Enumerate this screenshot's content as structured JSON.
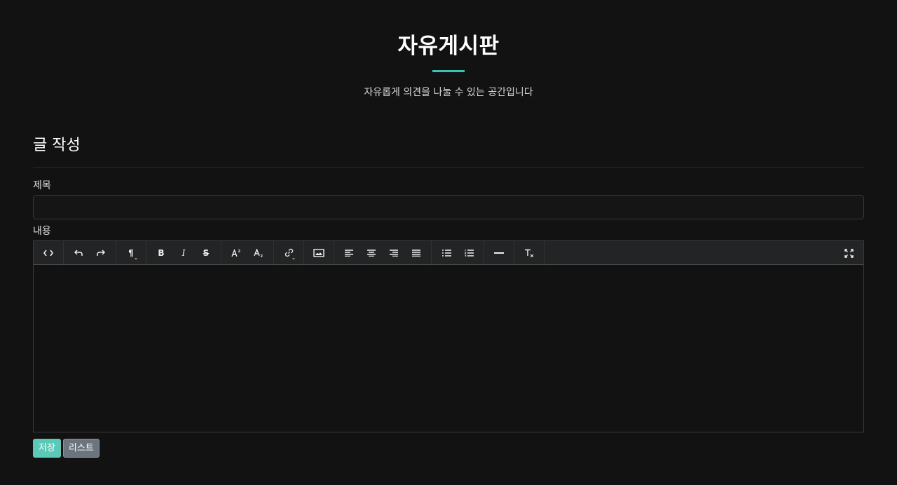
{
  "header": {
    "title": "자유게시판",
    "subtitle": "자유롭게 의견을 나눌 수 있는 공간입니다",
    "accent_color": "#3cc2b0"
  },
  "form": {
    "section_title": "글 작성",
    "title_label": "제목",
    "title_value": "",
    "content_label": "내용",
    "content_value": ""
  },
  "toolbar": {
    "groups": [
      [
        "code-view-icon"
      ],
      [
        "undo-icon",
        "redo-icon"
      ],
      [
        "paragraph-icon"
      ],
      [
        "bold-icon",
        "italic-icon",
        "strikethrough-icon"
      ],
      [
        "superscript-icon",
        "subscript-icon"
      ],
      [
        "link-icon"
      ],
      [
        "image-icon"
      ],
      [
        "align-left-icon",
        "align-center-icon",
        "align-right-icon",
        "align-justify-icon"
      ],
      [
        "bullet-list-icon",
        "numbered-list-icon"
      ],
      [
        "horizontal-rule-icon"
      ],
      [
        "clear-format-icon"
      ]
    ],
    "fullscreen_icon": "fullscreen-icon"
  },
  "actions": {
    "save_label": "저장",
    "list_label": "리스트",
    "save_color": "#5cc9b8",
    "list_color": "#6c757d"
  }
}
